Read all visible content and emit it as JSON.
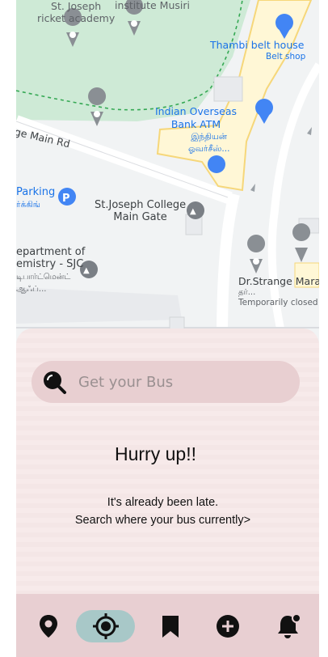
{
  "map": {
    "labels": {
      "cricket_academy": [
        "St. Joseph",
        "ricket academy"
      ],
      "institute": "institute Musiri",
      "belt_house": "Thambi belt house",
      "belt_shop": "Belt shop",
      "iob_atm": [
        "Indian Overseas",
        "Bank ATM"
      ],
      "iob_tamil": [
        "இந்தியன்",
        "ஓவர்சீஸ்..."
      ],
      "main_road": "ge Main Rd",
      "parking": "Parking",
      "parking_tamil": "ர்க்கிங்",
      "sjc_gate": [
        "St.Joseph College",
        "Main Gate"
      ],
      "dept": [
        "epartment of",
        "emistry - SJC"
      ],
      "dept_tamil": [
        "டிபார்ட்மென்ட்",
        "ஆஃப்..."
      ],
      "strange": "Dr.Strange Mara",
      "strange_tamil": "தர்...",
      "strange_status": "Temporarily closed"
    }
  },
  "search": {
    "placeholder": "Get your Bus"
  },
  "message": {
    "headline": "Hurry up!!",
    "line1": "It's already been late.",
    "line2": "Search where your bus currently>"
  },
  "nav": {
    "items": [
      {
        "icon": "location-pin-icon"
      },
      {
        "icon": "crosshair-locate-icon",
        "active": true
      },
      {
        "icon": "bookmark-icon"
      },
      {
        "icon": "add-circle-icon"
      },
      {
        "icon": "notification-bell-icon"
      }
    ]
  },
  "colors": {
    "sheet_bg": "#f4e6e6",
    "search_bg": "#e8cfd1",
    "nav_bg": "#e8cfd2",
    "nav_active": "#a8c8c8",
    "map_green": "#ceead6",
    "map_blue": "#1a73e8"
  }
}
